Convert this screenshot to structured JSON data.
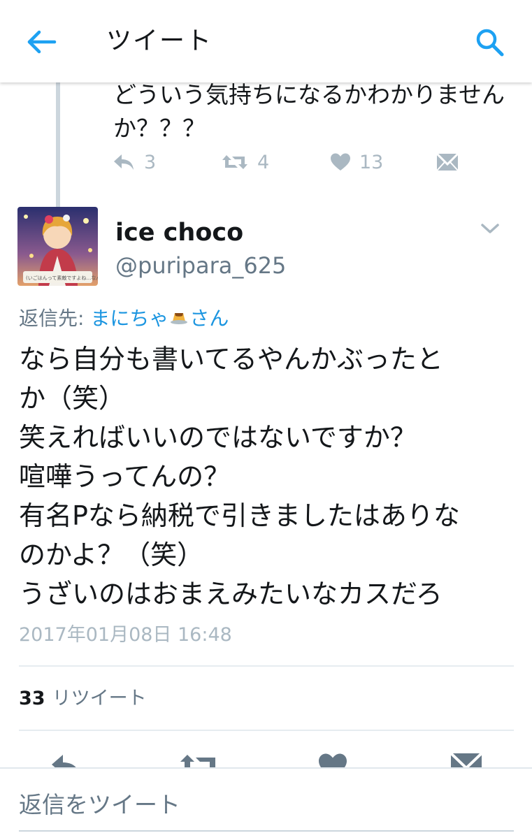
{
  "header": {
    "title": "ツイート",
    "back_icon": "arrow-left-icon",
    "search_icon": "search-icon",
    "accent_color": "#1da1f2"
  },
  "previous_tweet": {
    "text_lines": [
      "どういう気持ちになるかわかりませんか？？？"
    ],
    "text_line_1": "どういう気持ちになるかわかりません",
    "text_line_2": "か？？？",
    "reply_count": "3",
    "retweet_count": "4",
    "like_count": "13"
  },
  "tweet": {
    "display_name": "ice choco",
    "handle": "@puripara_625",
    "reply_prefix": "返信先: ",
    "reply_target": "まにちゃ",
    "reply_suffix": "さん",
    "body_lines": [
      "なら自分も書いてるやんかぶったと",
      "か（笑）",
      "笑えればいいのではないですか？",
      "喧嘩うってんの？",
      "有名Pなら納税で引きましたはありな",
      "のかよ？（笑）",
      "うざいのはおまえみたいなカスだろ"
    ],
    "timestamp": "2017年01月08日 16:48",
    "retweet_count": "33",
    "retweet_label": "リツイート"
  },
  "composer": {
    "placeholder": "返信をツイート"
  }
}
